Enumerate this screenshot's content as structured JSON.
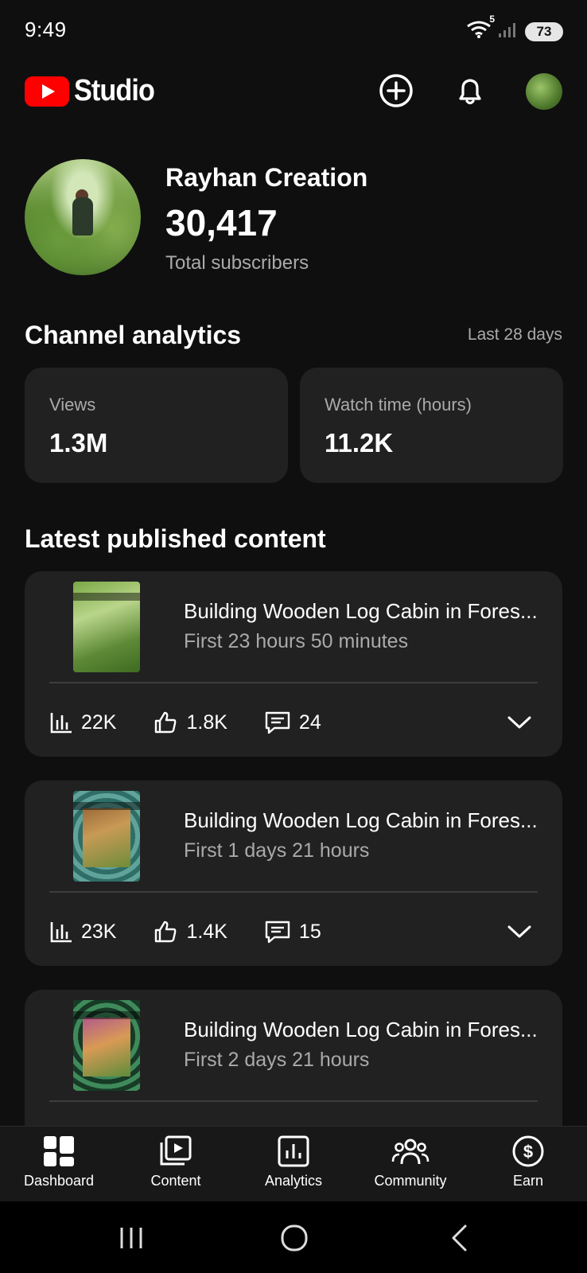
{
  "status_bar": {
    "time": "9:49",
    "battery": "73",
    "wifi_tag": "5"
  },
  "header": {
    "studio_label": "Studio",
    "icons": [
      "create-plus-icon",
      "notifications-bell-icon",
      "account-avatar"
    ]
  },
  "channel": {
    "name": "Rayhan Creation",
    "subscriber_count": "30,417",
    "subscriber_label": "Total subscribers"
  },
  "analytics": {
    "title": "Channel analytics",
    "range": "Last 28 days",
    "cards": [
      {
        "label": "Views",
        "value": "1.3M"
      },
      {
        "label": "Watch time (hours)",
        "value": "11.2K"
      }
    ]
  },
  "latest": {
    "title": "Latest published content",
    "items": [
      {
        "title": "Building Wooden Log Cabin in Fores...",
        "subtitle": "First 23 hours 50 minutes",
        "views": "22K",
        "likes": "1.8K",
        "comments": "24"
      },
      {
        "title": "Building Wooden Log Cabin in Fores...",
        "subtitle": "First 1 days 21 hours",
        "views": "23K",
        "likes": "1.4K",
        "comments": "15"
      },
      {
        "title": "Building Wooden Log Cabin in Fores...",
        "subtitle": "First 2 days 21 hours"
      }
    ]
  },
  "bottom_nav": {
    "items": [
      {
        "label": "Dashboard",
        "icon": "dashboard-icon"
      },
      {
        "label": "Content",
        "icon": "content-icon"
      },
      {
        "label": "Analytics",
        "icon": "analytics-icon"
      },
      {
        "label": "Community",
        "icon": "community-icon"
      },
      {
        "label": "Earn",
        "icon": "earn-icon"
      }
    ]
  },
  "colors": {
    "background": "#0f0f0f",
    "card": "#212121",
    "brand_red": "#ff0000",
    "secondary_text": "#aaaaaa"
  }
}
